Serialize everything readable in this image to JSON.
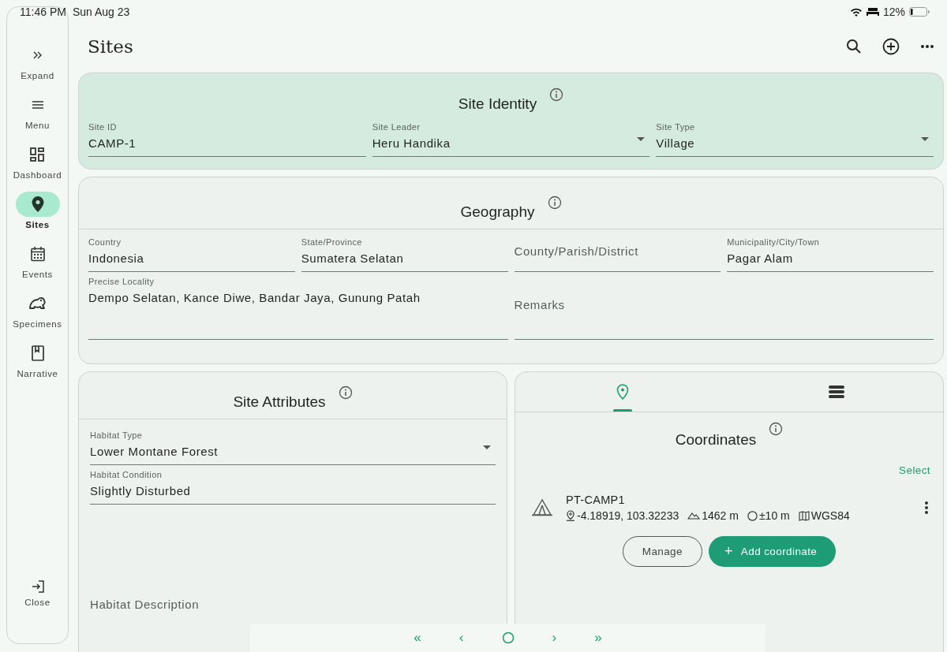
{
  "status_bar": {
    "time": "11:46 PM",
    "date": "Sun Aug 23",
    "battery": "12%"
  },
  "nav": {
    "items": [
      {
        "label": "Expand",
        "kind": "expand",
        "selected": false
      },
      {
        "label": "Menu",
        "kind": "menu",
        "selected": false
      },
      {
        "label": "Dashboard",
        "kind": "dashboard",
        "selected": false
      },
      {
        "label": "Sites",
        "kind": "sites",
        "selected": true
      },
      {
        "label": "Events",
        "kind": "events",
        "selected": false
      },
      {
        "label": "Specimens",
        "kind": "specimens",
        "selected": false
      },
      {
        "label": "Narrative",
        "kind": "narrative",
        "selected": false
      }
    ],
    "close": "Close"
  },
  "title": "Sites",
  "site_identity": {
    "title": "Site Identity",
    "fields": [
      {
        "label": "Site ID",
        "value": "CAMP-1",
        "kind": "text"
      },
      {
        "label": "Site Leader",
        "value": "Heru Handika",
        "kind": "select"
      },
      {
        "label": "Site Type",
        "value": "Village",
        "kind": "select"
      }
    ]
  },
  "geography": {
    "title": "Geography",
    "address_fields": [
      {
        "label": "Country",
        "value": "Indonesia",
        "kind": "text"
      },
      {
        "label": "State/Province",
        "value": "Sumatera Selatan",
        "kind": "text"
      },
      {
        "placeholder": "County/Parish/District",
        "kind": "text"
      },
      {
        "label": "Municipality/City/Town",
        "value": "Pagar Alam",
        "kind": "text"
      }
    ],
    "locality_fields": [
      {
        "label": "Precise Locality",
        "value": "Dempo Selatan, Kance Diwe, Bandar Jaya, Gunung Patah",
        "kind": "multiline"
      },
      {
        "placeholder": "Remarks",
        "kind": "multiline"
      }
    ]
  },
  "site_attributes": {
    "title": "Site Attributes",
    "fields": [
      {
        "label": "Habitat Type",
        "value": "Lower Montane Forest",
        "kind": "select"
      },
      {
        "label": "Habitat Condition",
        "value": "Slightly Disturbed",
        "kind": "text"
      }
    ],
    "description": {
      "placeholder": "Habitat Description"
    }
  },
  "coordinates_panel": {
    "tabs": [
      {
        "kind": "pin",
        "selected": true
      },
      {
        "kind": "list",
        "selected": false
      }
    ],
    "title": "Coordinates",
    "select_link": "Select",
    "points": [
      {
        "name": "PT-CAMP1",
        "latlon": "-4.18919, 103.32233",
        "elevation": "1462 m",
        "accuracy": "±10 m",
        "datum": "WGS84"
      }
    ],
    "buttons": {
      "manage": "Manage",
      "add": "Add coordinate",
      "add_glyph": "+"
    }
  },
  "pager": {
    "first": "«",
    "prev": "‹",
    "next": "›",
    "last": "»"
  }
}
